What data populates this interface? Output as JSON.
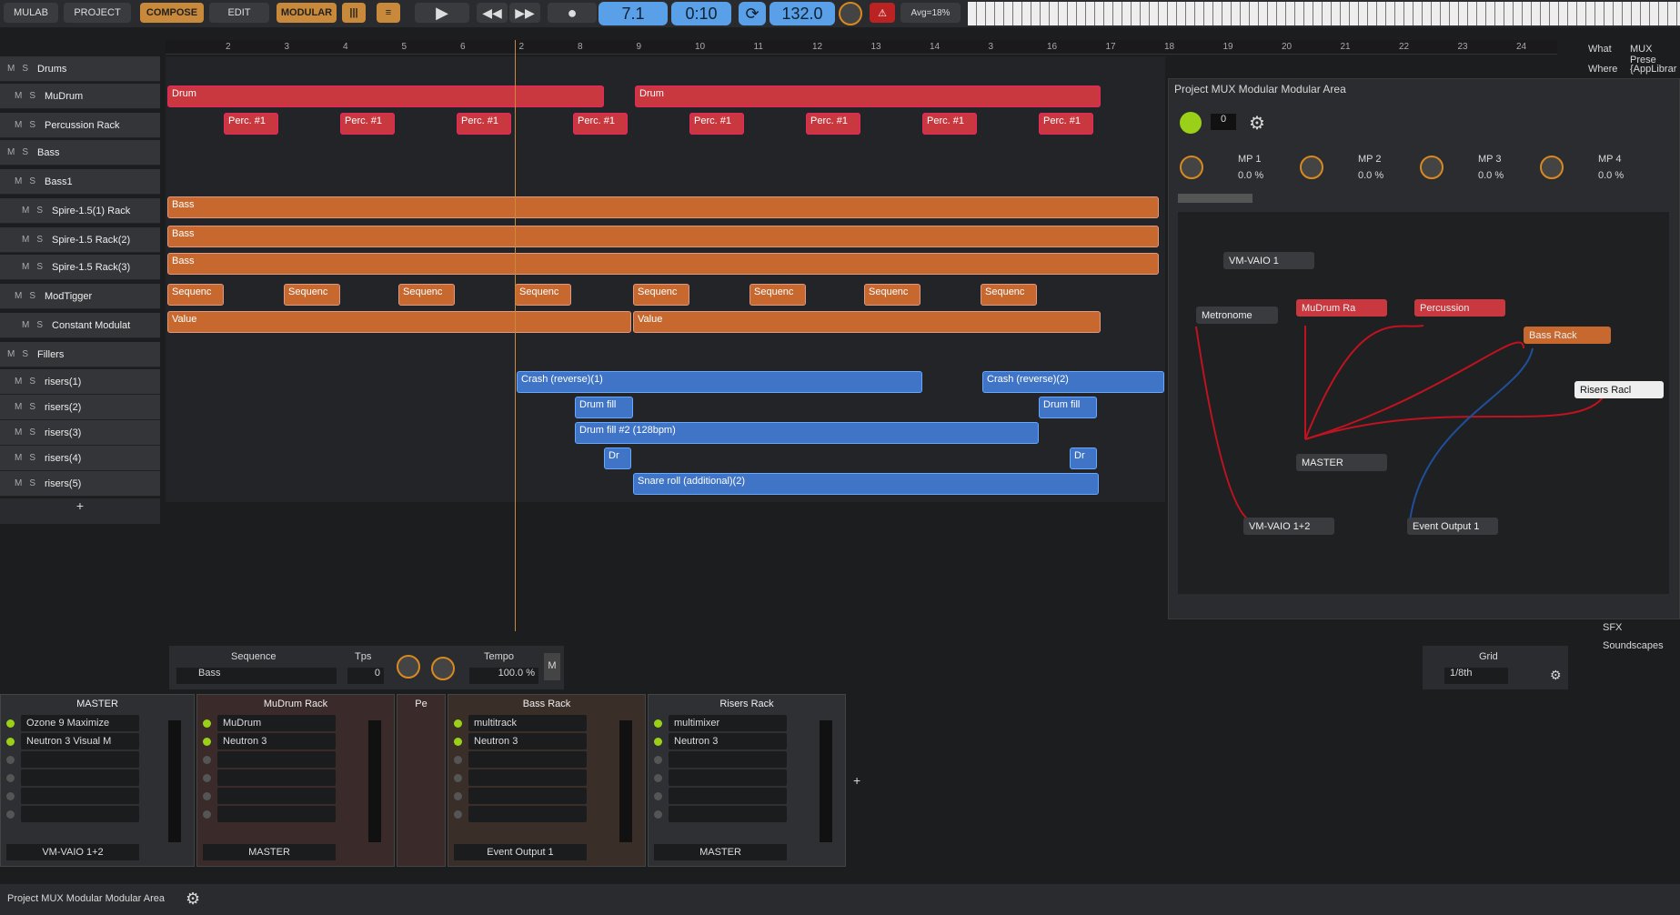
{
  "toolbar": {
    "mulab": "MULAB",
    "project": "PROJECT",
    "compose": "COMPOSE",
    "edit": "EDIT",
    "modular": "MODULAR",
    "bar": "7.1",
    "time": "0:10",
    "tempo": "132.0",
    "avg": "Avg=18%"
  },
  "right": {
    "what_label": "What",
    "what_value": "MUX Prese",
    "where_label": "Where",
    "where_value": "{AppLibrar",
    "sfx": "SFX",
    "soundscapes": "Soundscapes"
  },
  "ruler": [
    "2",
    "3",
    "4",
    "5",
    "6",
    "2",
    "8",
    "9",
    "10",
    "11",
    "12",
    "13",
    "14",
    "3",
    "16",
    "17",
    "18",
    "19",
    "20",
    "21",
    "22",
    "23",
    "24"
  ],
  "tracks": [
    {
      "name": "Drums",
      "lvl": 0
    },
    {
      "name": "MuDrum",
      "lvl": 1
    },
    {
      "name": "Percussion Rack",
      "lvl": 1
    },
    {
      "name": "Bass",
      "lvl": 0
    },
    {
      "name": "Bass1",
      "lvl": 1
    },
    {
      "name": "Spire-1.5(1) Rack",
      "lvl": 2
    },
    {
      "name": "Spire-1.5 Rack(2)",
      "lvl": 2
    },
    {
      "name": "Spire-1.5 Rack(3)",
      "lvl": 2
    },
    {
      "name": "ModTigger",
      "lvl": 1
    },
    {
      "name": "Constant Modulat",
      "lvl": 2
    },
    {
      "name": "Fillers",
      "lvl": 0
    },
    {
      "name": "risers(1)",
      "lvl": 1
    },
    {
      "name": "risers(2)",
      "lvl": 1
    },
    {
      "name": "risers(3)",
      "lvl": 1
    },
    {
      "name": "risers(4)",
      "lvl": 1
    },
    {
      "name": "risers(5)",
      "lvl": 1
    }
  ],
  "clips": {
    "drum": "Drum",
    "perc": "Perc. #1",
    "bass": "Bass",
    "seq": "Sequenc",
    "value": "Value",
    "crash1": "Crash (reverse)(1)",
    "crash2": "Crash (reverse)(2)",
    "fill": "Drum fill",
    "fill2": "Drum fill #2 (128bpm)",
    "dr": "Dr",
    "snare": "Snare roll (additional)(2)"
  },
  "modular": {
    "title": "Project MUX Modular Modular Area",
    "num": "0",
    "mp": [
      {
        "n": "MP 1",
        "v": "0.0 %"
      },
      {
        "n": "MP 2",
        "v": "0.0 %"
      },
      {
        "n": "MP 3",
        "v": "0.0 %"
      },
      {
        "n": "MP 4",
        "v": "0.0 %"
      }
    ],
    "nodes": {
      "vm1": "VM-VAIO 1",
      "metro": "Metronome",
      "mudrum": "MuDrum Ra",
      "perc": "Percussion",
      "bassrack": "Bass Rack",
      "risers": "Risers Racl",
      "master": "MASTER",
      "vm12": "VM-VAIO 1+2",
      "evout": "Event Output 1"
    }
  },
  "seqpanel": {
    "sequence": "Sequence",
    "seqval": "Bass",
    "tps": "Tps",
    "tpsval": "0",
    "tempo": "Tempo",
    "tempoval": "100.0 %",
    "m": "M",
    "grid": "Grid",
    "gridval": "1/8th"
  },
  "mixer": [
    {
      "name": "MASTER",
      "slots": [
        "Ozone 9 Maximize",
        "Neutron 3 Visual M"
      ],
      "out": "VM-VAIO 1+2"
    },
    {
      "name": "MuDrum Rack",
      "slots": [
        "MuDrum",
        "Neutron 3"
      ],
      "out": "MASTER"
    },
    {
      "name": "Pe",
      "slots": [],
      "out": ""
    },
    {
      "name": "Bass Rack",
      "slots": [
        "multitrack",
        "Neutron 3"
      ],
      "out": "Event Output 1"
    },
    {
      "name": "Risers Rack",
      "slots": [
        "multimixer",
        "Neutron 3"
      ],
      "out": "MASTER"
    }
  ],
  "status": {
    "label": "Project MUX Modular Modular Area"
  },
  "colors": {
    "accent": "#c88a3a",
    "lcd": "#5aa0e8",
    "red": "#c9383e",
    "orange": "#c7682f",
    "blue": "#3f74c6"
  }
}
